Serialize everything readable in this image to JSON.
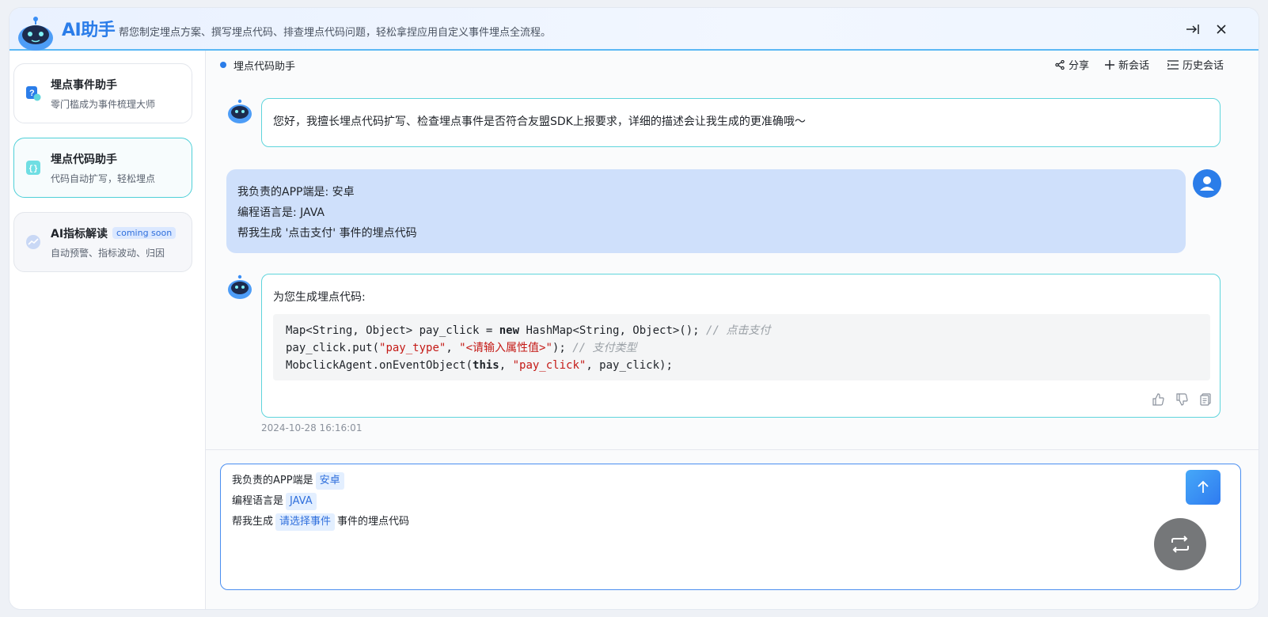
{
  "header": {
    "title": "AI助手",
    "description": "帮您制定埋点方案、撰写埋点代码、排查埋点代码问题，轻松拿捏应用自定义事件埋点全流程。"
  },
  "sidebar": {
    "items": [
      {
        "title": "埋点事件助手",
        "subtitle": "零门槛成为事件梳理大师"
      },
      {
        "title": "埋点代码助手",
        "subtitle": "代码自动扩写，轻松埋点"
      },
      {
        "title": "AI指标解读",
        "badge": "coming soon",
        "subtitle": "自动预警、指标波动、归因"
      }
    ]
  },
  "topbar": {
    "current": "埋点代码助手",
    "share": "分享",
    "new_chat": "新会话",
    "history": "历史会话"
  },
  "messages": {
    "greeting": "您好，我擅长埋点代码扩写、检查埋点事件是否符合友盟SDK上报要求，详细的描述会让我生成的更准确哦～",
    "user_lines": [
      "我负责的APP端是: 安卓",
      "编程语言是: JAVA",
      "帮我生成 '点击支付' 事件的埋点代码"
    ],
    "reply_intro": "为您生成埋点代码:",
    "code": {
      "l1_a": "Map<String, Object> pay_click = ",
      "l1_kw": "new",
      "l1_b": " HashMap<String, Object>(); ",
      "l1_cm": "// 点击支付",
      "l2_a": "pay_click.put(",
      "l2_s1": "\"pay_type\"",
      "l2_b": ", ",
      "l2_s2": "\"<请输入属性值>\"",
      "l2_c": "); ",
      "l2_cm": "// 支付类型",
      "l3_a": "MobclickAgent.onEventObject(",
      "l3_kw": "this",
      "l3_b": ", ",
      "l3_s": "\"pay_click\"",
      "l3_c": ", pay_click);"
    },
    "timestamp": "2024-10-28 16:16:01"
  },
  "input": {
    "line1_prefix": "我负责的APP端是",
    "line1_tag": "安卓",
    "line2_prefix": "编程语言是",
    "line2_tag": "JAVA",
    "line3_prefix": "帮我生成",
    "line3_tag": "请选择事件",
    "line3_suffix": "事件的埋点代码"
  },
  "colors": {
    "accent": "#2b7de9",
    "bot_border": "#5fd5dc",
    "user_bubble": "#cfe0fb"
  }
}
